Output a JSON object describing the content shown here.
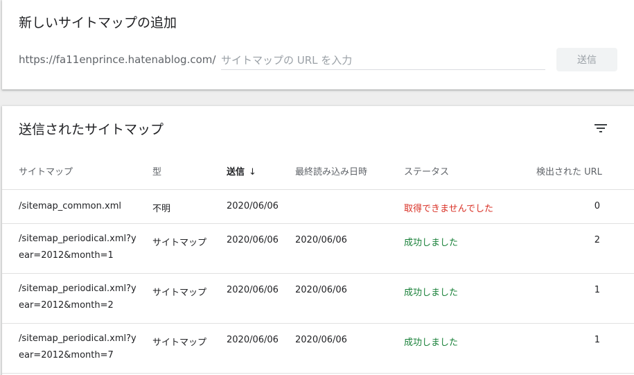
{
  "add_card": {
    "title": "新しいサイトマップの追加",
    "url_prefix": "https://fa11enprince.hatenablog.com/",
    "input_placeholder": "サイトマップの URL を入力",
    "input_value": "",
    "submit_label": "送信"
  },
  "list_card": {
    "title": "送信されたサイトマップ",
    "columns": {
      "sitemap": "サイトマップ",
      "type": "型",
      "submitted": "送信",
      "last_read": "最終読み込み日時",
      "status": "ステータス",
      "discovered": "検出された URL"
    },
    "rows": [
      {
        "sitemap": "/sitemap_common.xml",
        "type": "不明",
        "submitted": "2020/06/06",
        "last_read": "",
        "status": "取得できませんでした",
        "count": "0"
      },
      {
        "sitemap": "/sitemap_periodical.xml?year=2012&month=1",
        "type": "サイトマップ",
        "submitted": "2020/06/06",
        "last_read": "2020/06/06",
        "status": "成功しました",
        "count": "2"
      },
      {
        "sitemap": "/sitemap_periodical.xml?year=2012&month=2",
        "type": "サイトマップ",
        "submitted": "2020/06/06",
        "last_read": "2020/06/06",
        "status": "成功しました",
        "count": "1"
      },
      {
        "sitemap": "/sitemap_periodical.xml?year=2012&month=7",
        "type": "サイトマップ",
        "submitted": "2020/06/06",
        "last_read": "2020/06/06",
        "status": "成功しました",
        "count": "1"
      }
    ]
  },
  "colors": {
    "error": "#d93025",
    "success": "#188038"
  },
  "icons": {
    "filter": "filter-icon",
    "sort": "arrow-down-icon"
  }
}
